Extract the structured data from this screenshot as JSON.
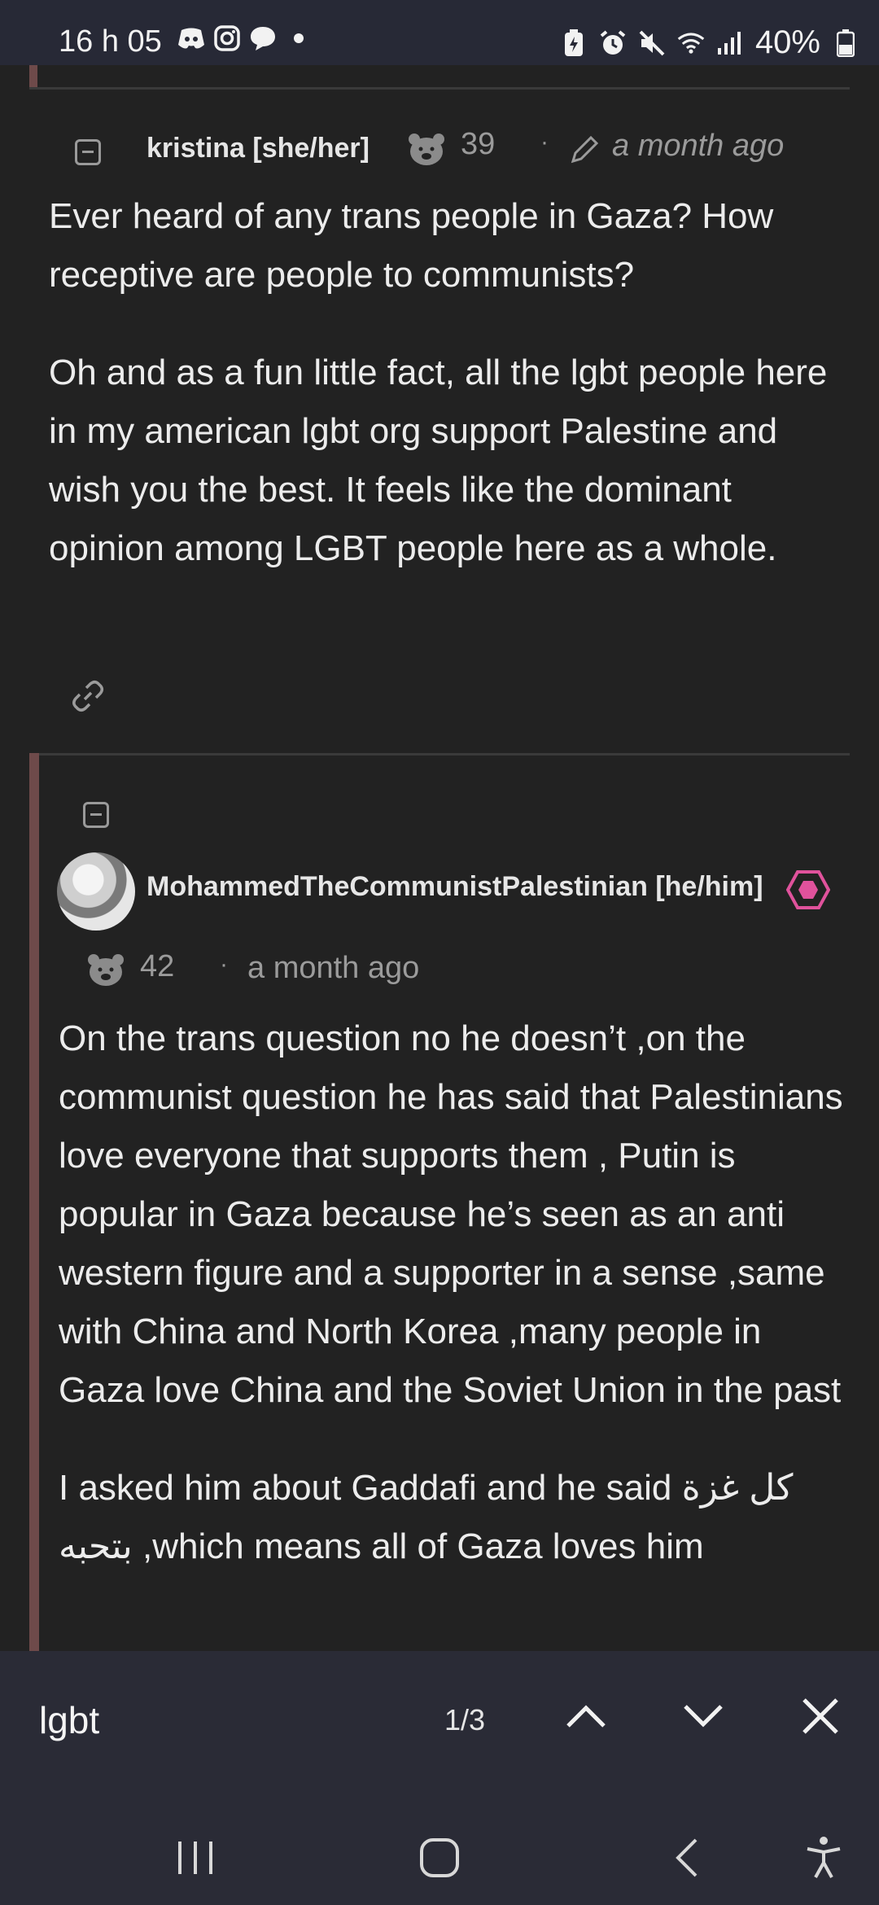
{
  "status": {
    "time": "16 h 05",
    "battery": "40%",
    "left_icons": [
      "discord-icon",
      "instagram-icon",
      "chat-bubble-icon",
      "dot-icon"
    ],
    "right_icons": [
      "battery-saver-icon",
      "alarm-icon",
      "mute-icon",
      "wifi-icon",
      "signal-icon",
      "battery-icon"
    ]
  },
  "comments": [
    {
      "username": "kristina [she/her]",
      "score": "39",
      "separator": "·",
      "time": "a month ago",
      "paragraphs": [
        "Ever heard of any trans people in Gaza? How receptive are people to communists?",
        "Oh and as a fun little fact, all the lgbt people here in my american lgbt org support Palestine and wish you the best. It feels like the dominant opinion among LGBT people here as a whole."
      ]
    },
    {
      "username": "MohammedTheCommunistPalestinian [he/him]",
      "score": "42",
      "separator": "·",
      "time": "a month ago",
      "paragraphs": [
        "On the trans question no he doesn’t ,on the communist question he has said that Palestinians love everyone that supports them , Putin is popular in Gaza because he’s seen as an anti western figure and a supporter in a sense ,same with China and North Korea ,many people in Gaza love China and the Soviet Union in the past",
        "I asked him about Gaddafi and he said كل غزة بتحبه ,which means all of Gaza loves him"
      ]
    }
  ],
  "find": {
    "query": "lgbt",
    "count": "1/3"
  },
  "colors": {
    "background": "#222222",
    "thread_border": "#6e4a4a",
    "badge": "#e0529c",
    "bar": "#2a2b36"
  }
}
